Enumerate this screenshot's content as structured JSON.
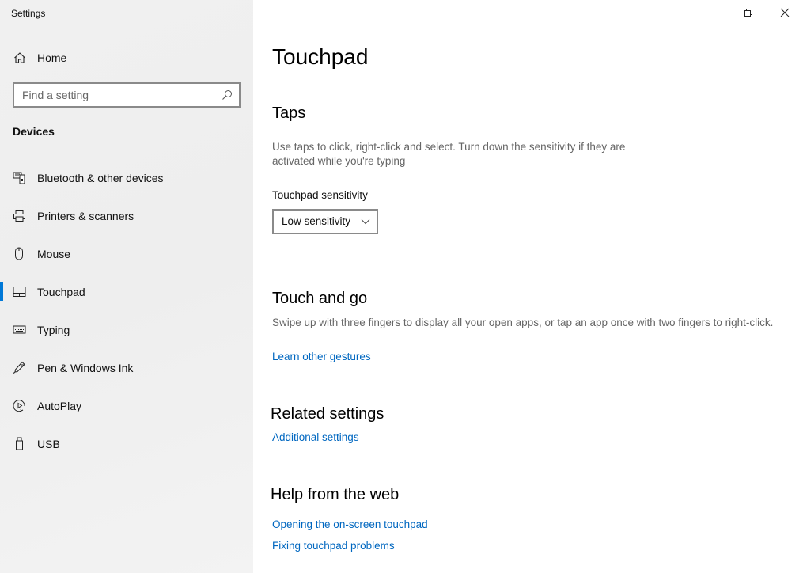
{
  "window": {
    "title": "Settings",
    "controls": {
      "minimize": "minimize-icon",
      "restore": "restore-icon",
      "close": "close-icon"
    }
  },
  "sidebar": {
    "home_label": "Home",
    "home_icon": "home-icon",
    "search": {
      "placeholder": "Find a setting",
      "value": "",
      "icon": "search-icon"
    },
    "section_label": "Devices",
    "items": [
      {
        "label": "Bluetooth & other devices",
        "icon": "bluetooth-devices-icon",
        "active": false
      },
      {
        "label": "Printers & scanners",
        "icon": "printer-icon",
        "active": false
      },
      {
        "label": "Mouse",
        "icon": "mouse-icon",
        "active": false
      },
      {
        "label": "Touchpad",
        "icon": "touchpad-icon",
        "active": true
      },
      {
        "label": "Typing",
        "icon": "keyboard-icon",
        "active": false
      },
      {
        "label": "Pen & Windows Ink",
        "icon": "pen-icon",
        "active": false
      },
      {
        "label": "AutoPlay",
        "icon": "autoplay-icon",
        "active": false
      },
      {
        "label": "USB",
        "icon": "usb-icon",
        "active": false
      }
    ],
    "accent_color": "#0078d7"
  },
  "main": {
    "title": "Touchpad",
    "taps": {
      "heading": "Taps",
      "description": "Use taps to click, right-click and select. Turn down the sensitivity if they are activated while you're typing",
      "sensitivity_label": "Touchpad sensitivity",
      "sensitivity_value": "Low sensitivity"
    },
    "touch_and_go": {
      "heading": "Touch and go",
      "description": "Swipe up with three fingers to display all your open apps, or tap an app once with two fingers to right-click.",
      "link": "Learn other gestures"
    },
    "related": {
      "heading": "Related settings",
      "link": "Additional settings"
    },
    "help": {
      "heading": "Help from the web",
      "links": [
        "Opening the on-screen touchpad",
        "Fixing touchpad problems"
      ]
    },
    "link_color": "#0067c0"
  }
}
